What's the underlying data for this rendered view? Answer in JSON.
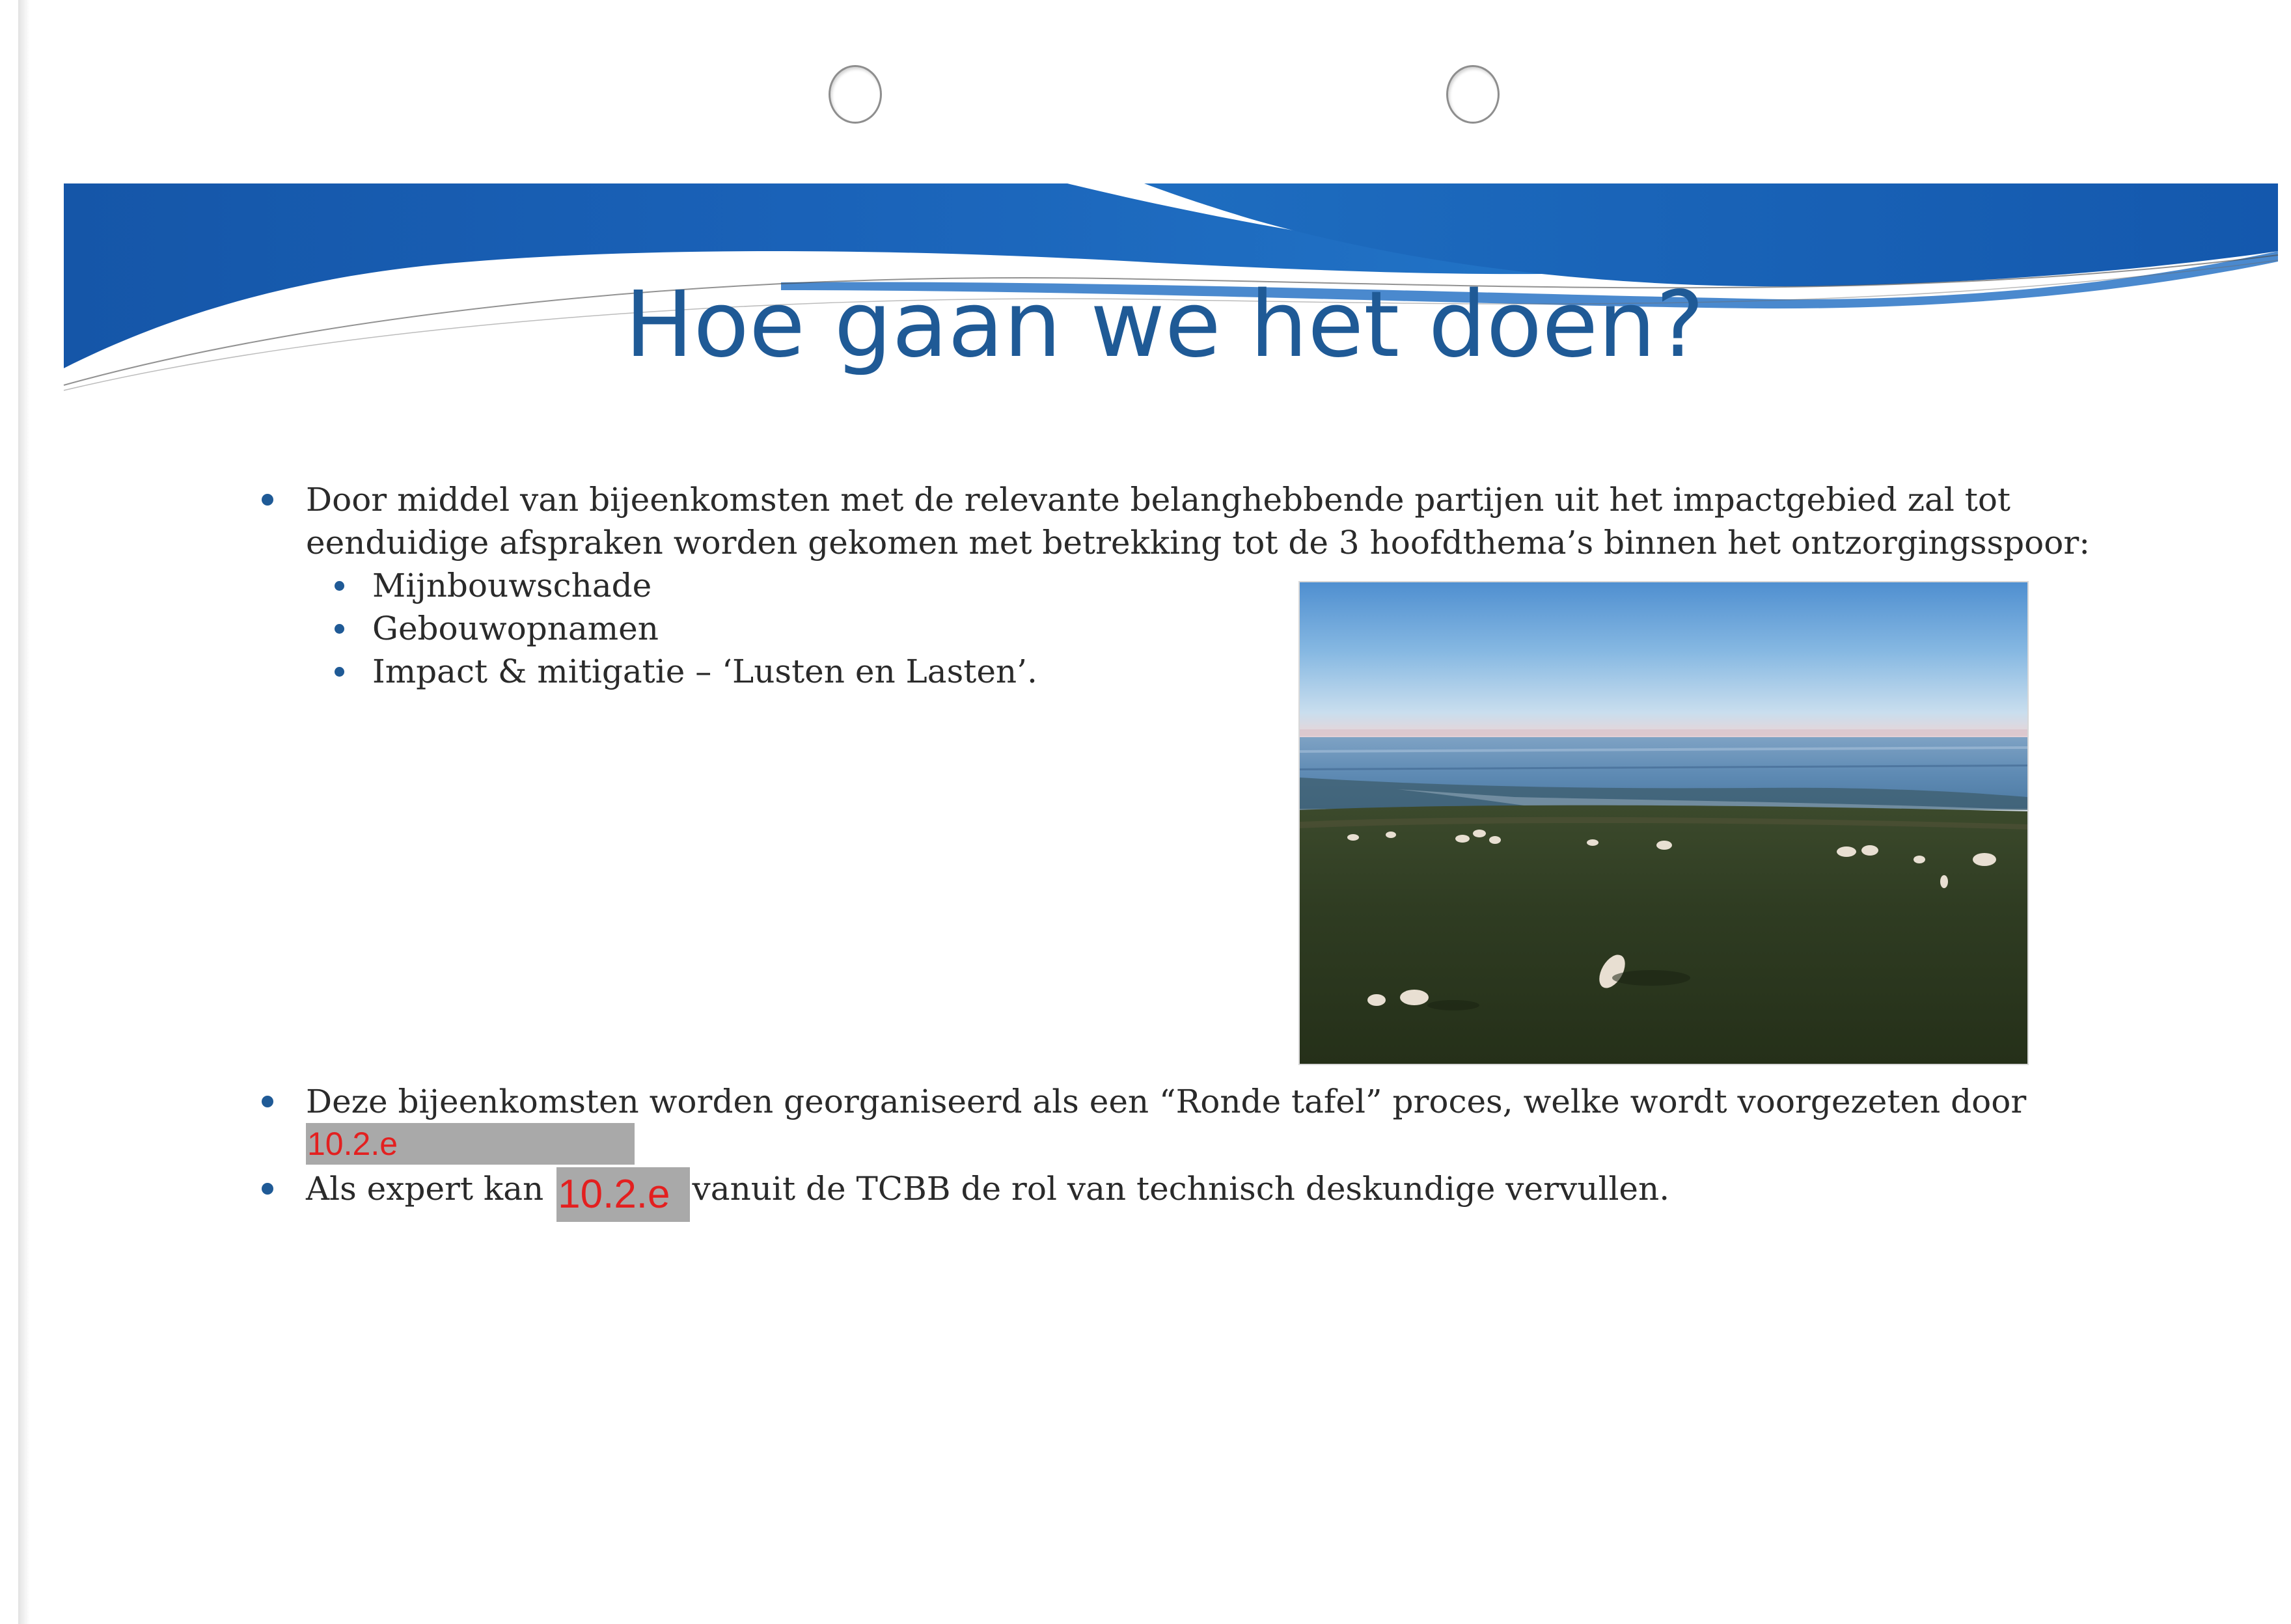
{
  "slide": {
    "title": "Hoe gaan we het doen?"
  },
  "bullets": [
    {
      "text": "Door middel van bijeenkomsten met de relevante belanghebbende partijen uit het impactgebied zal tot eenduidige afspraken worden gekomen met betrekking tot de 3 hoofdthema’s binnen het ontzorgingsspoor:",
      "sub_items": [
        "Mijnbouwschade",
        "Gebouwopnamen",
        "Impact & mitigatie – ‘Lusten en Lasten’."
      ]
    },
    {
      "text": "Deze bijeenkomsten worden georganiseerd als een “Ronde tafel” proces, welke wordt voorgezeten  door",
      "redaction": "10.2.e"
    },
    {
      "text_before": "Als expert kan",
      "redaction": "10.2.e",
      "text_after": "vanuit de TCBB de rol van technisch deskundige vervullen."
    }
  ],
  "colors": {
    "title": "#1f5a96",
    "wave_dark": "#1556a8",
    "wave_light": "#2e7cd0",
    "bullet": "#1f5a96",
    "redaction_bg": "#a9a9a9",
    "redaction_text": "#e32020"
  },
  "photo": {
    "subject": "sheep grazing on a dike beside the Wadden Sea"
  }
}
